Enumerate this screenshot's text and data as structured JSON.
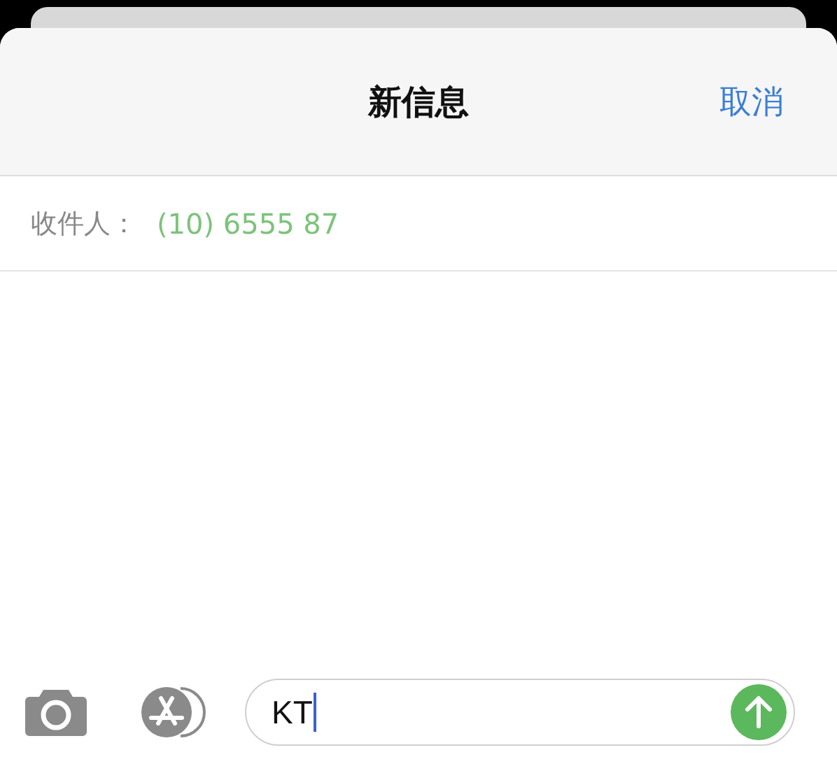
{
  "header": {
    "title": "新信息",
    "cancel": "取消"
  },
  "recipient": {
    "label": "收件人：",
    "value": "(10) 6555 87"
  },
  "composer": {
    "value": "KT"
  }
}
